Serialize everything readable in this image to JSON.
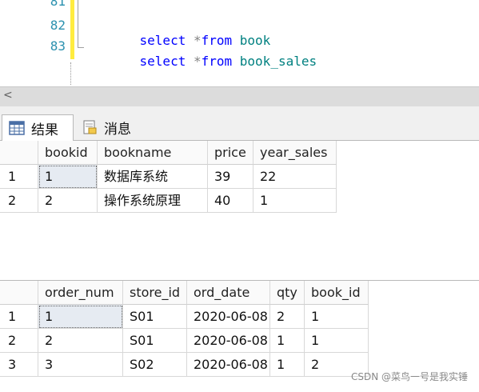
{
  "editor": {
    "lines": [
      {
        "num": "81",
        "tokens": []
      },
      {
        "num": "82",
        "tokens": [
          {
            "t": "select",
            "c": "kw"
          },
          {
            "t": " ",
            "c": ""
          },
          {
            "t": "*",
            "c": "op"
          },
          {
            "t": "from",
            "c": "kw"
          },
          {
            "t": " ",
            "c": ""
          },
          {
            "t": "book",
            "c": "id"
          }
        ]
      },
      {
        "num": "83",
        "tokens": [
          {
            "t": "select",
            "c": "kw"
          },
          {
            "t": " ",
            "c": ""
          },
          {
            "t": "*",
            "c": "op"
          },
          {
            "t": "from",
            "c": "kw"
          },
          {
            "t": " ",
            "c": ""
          },
          {
            "t": "book_sales",
            "c": "id"
          }
        ]
      }
    ]
  },
  "scrollbar": {
    "left_arrow": "<"
  },
  "tabs": {
    "results_label": "结果",
    "messages_label": "消息"
  },
  "grid1": {
    "columns": [
      "bookid",
      "bookname",
      "price",
      "year_sales"
    ],
    "rows": [
      {
        "num": "1",
        "cells": [
          "1",
          "数据库系统",
          "39",
          "22"
        ]
      },
      {
        "num": "2",
        "cells": [
          "2",
          "操作系统原理",
          "40",
          "1"
        ]
      }
    ]
  },
  "grid2": {
    "columns": [
      "order_num",
      "store_id",
      "ord_date",
      "qty",
      "book_id"
    ],
    "rows": [
      {
        "num": "1",
        "cells": [
          "1",
          "S01",
          "2020-06-08",
          "2",
          "1"
        ]
      },
      {
        "num": "2",
        "cells": [
          "2",
          "S01",
          "2020-06-08",
          "1",
          "1"
        ]
      },
      {
        "num": "3",
        "cells": [
          "3",
          "S02",
          "2020-06-08",
          "1",
          "2"
        ]
      }
    ]
  },
  "watermark": "CSDN @菜鸟一号是我实锤"
}
